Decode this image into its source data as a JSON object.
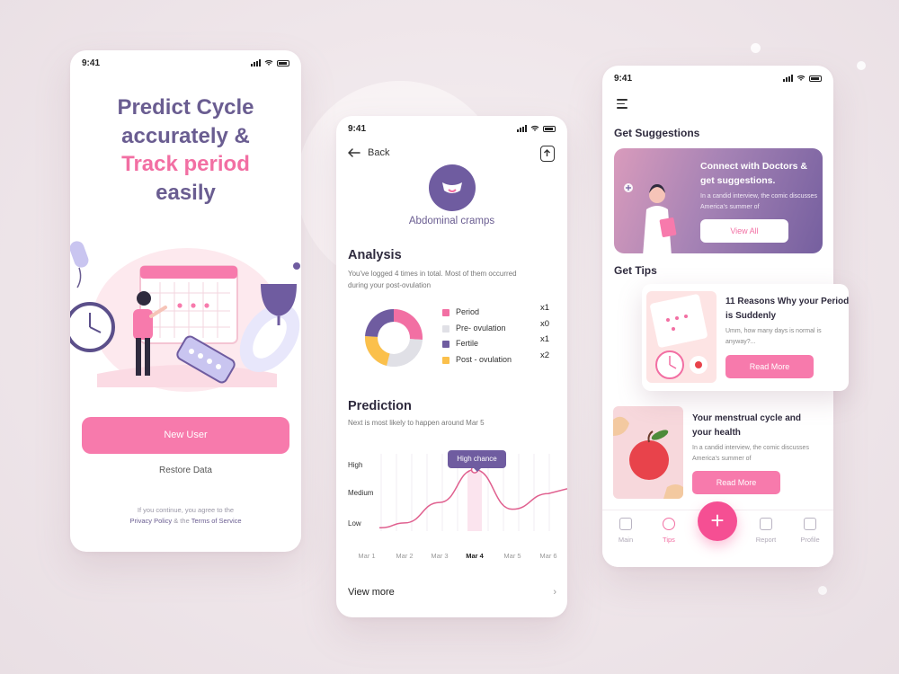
{
  "colors": {
    "primary_pink": "#f77aac",
    "deep_pink": "#f54f93",
    "purple": "#6a5d91",
    "legend_period": "#f26fa3",
    "legend_pre_ovulation": "#e0e0e6",
    "legend_fertile": "#6f5ca0",
    "legend_post_ovulation": "#fbc04b"
  },
  "status": {
    "time": "9:41"
  },
  "onboarding": {
    "title_line1": "Predict Cycle",
    "title_line2": "accurately &",
    "title_line3": "Track period",
    "title_line4": "easily",
    "new_user_label": "New User",
    "restore_label": "Restore Data",
    "terms_prefix": "If you continue, you agree to the",
    "privacy_link": "Privacy Policy",
    "terms_mid": " & the ",
    "terms_link": "Terms of Service"
  },
  "symptom": {
    "back_label": "Back",
    "symptom_name": "Abdominal cramps",
    "analysis_title": "Analysis",
    "analysis_sub": "You've logged 4 times in total. Most of them occurred during your post-ovulation",
    "legend": [
      {
        "label": "Period",
        "count": "x1"
      },
      {
        "label": "Pre- ovulation",
        "count": "x0"
      },
      {
        "label": "Fertile",
        "count": "x1"
      },
      {
        "label": "Post - ovulation",
        "count": "x2"
      }
    ],
    "prediction_title": "Prediction",
    "prediction_sub": "Next is most likely to happen around Mar 5",
    "tooltip": "High chance",
    "view_more": "View more"
  },
  "chart_data": {
    "type": "line",
    "x": [
      "Mar 1",
      "Mar 2",
      "Mar 3",
      "Mar 4",
      "Mar 5",
      "Mar 6"
    ],
    "y_levels": [
      "High",
      "Medium",
      "Low"
    ],
    "highlight": "Mar 4",
    "series": [
      {
        "values": [
          0.05,
          0.12,
          0.42,
          0.9,
          0.32,
          0.55
        ]
      }
    ],
    "ylim": [
      0,
      1
    ]
  },
  "donut": {
    "segments": [
      {
        "name": "Period",
        "value": 1,
        "color": "#f26fa3"
      },
      {
        "name": "Fertile",
        "value": 1,
        "color": "#6f5ca0"
      },
      {
        "name": "Post - ovulation",
        "value": 2,
        "color": "#fbc04b"
      },
      {
        "name": "Pre- ovulation",
        "value": 0,
        "color": "#e0e0e6"
      }
    ]
  },
  "tips_screen": {
    "suggestions_title": "Get Suggestions",
    "doctor_card_title": "Connect with Doctors & get suggestions.",
    "doctor_card_desc": "In a candid interview, the comic discusses America's summer of",
    "view_all_label": "View All",
    "tips_title": "Get Tips",
    "tip1_title": "11 Reasons Why your Period is Suddenly",
    "tip1_desc": "Umm, how many days is normal is anyway?...",
    "tip2_title": "Your menstrual cycle and your health",
    "tip2_desc": "In a candid interview, the comic discusses America's summer of",
    "read_more": "Read More",
    "nav": {
      "main": "Main",
      "tips": "Tips",
      "report": "Report",
      "profile": "Profile",
      "fab": "+"
    }
  }
}
